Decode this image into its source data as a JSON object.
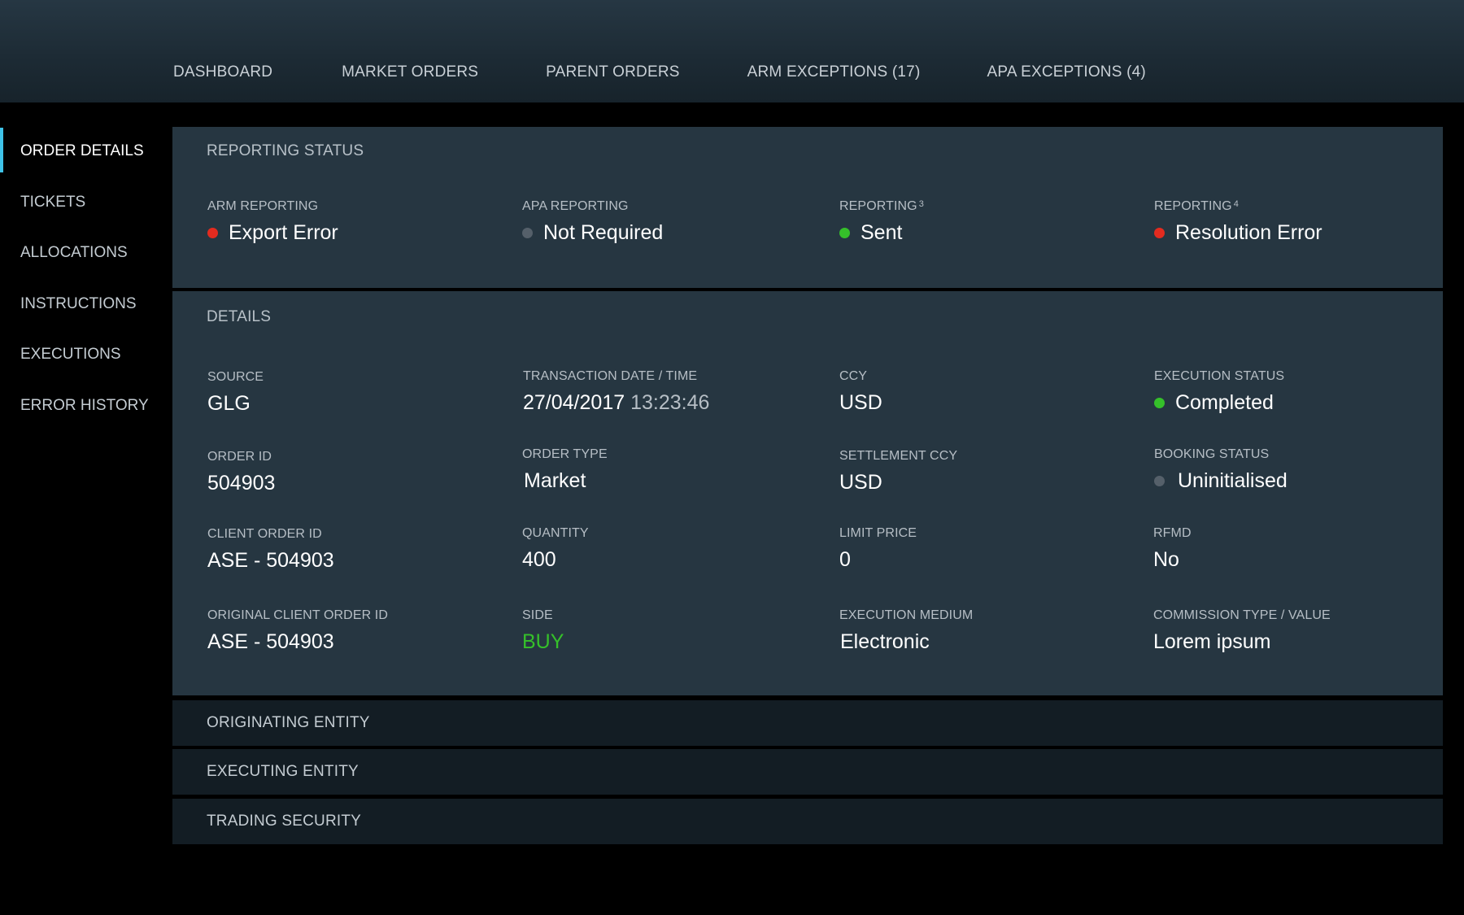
{
  "topnav": {
    "items": [
      {
        "label": "DASHBOARD"
      },
      {
        "label": "MARKET ORDERS"
      },
      {
        "label": "PARENT ORDERS"
      },
      {
        "label": "ARM EXCEPTIONS (17)"
      },
      {
        "label": "APA EXCEPTIONS (4)"
      }
    ]
  },
  "sidebar": {
    "items": [
      {
        "label": "ORDER DETAILS",
        "active": true
      },
      {
        "label": "TICKETS"
      },
      {
        "label": "ALLOCATIONS"
      },
      {
        "label": "INSTRUCTIONS"
      },
      {
        "label": "EXECUTIONS"
      },
      {
        "label": "ERROR HISTORY"
      }
    ]
  },
  "reporting_status": {
    "title": "REPORTING STATUS",
    "arm": {
      "label": "ARM REPORTING",
      "value": "Export Error",
      "status_color": "#e32b1f"
    },
    "apa": {
      "label": "APA REPORTING",
      "value": "Not Required",
      "status_color": "#55606a"
    },
    "rep3": {
      "label": "REPORTING",
      "sup": "3",
      "value": "Sent",
      "status_color": "#35c02a"
    },
    "rep4": {
      "label": "REPORTING",
      "sup": "4",
      "value": "Resolution Error",
      "status_color": "#e32b1f"
    }
  },
  "details": {
    "title": "DETAILS",
    "source": {
      "label": "SOURCE",
      "value": "GLG"
    },
    "transaction": {
      "label": "TRANSACTION DATE / TIME",
      "date": "27/04/2017",
      "time": "13:23:46"
    },
    "ccy": {
      "label": "CCY",
      "value": "USD"
    },
    "execution_status": {
      "label": "EXECUTION STATUS",
      "value": "Completed",
      "status_color": "#35c02a"
    },
    "order_id": {
      "label": "ORDER ID",
      "value": "504903"
    },
    "order_type": {
      "label": "ORDER TYPE",
      "value": "Market"
    },
    "settlement_ccy": {
      "label": "SETTLEMENT CCY",
      "value": "USD"
    },
    "booking_status": {
      "label": "BOOKING STATUS",
      "value": "Uninitialised",
      "status_color": "#55606a"
    },
    "client_order_id": {
      "label": "CLIENT ORDER ID",
      "value": "ASE - 504903"
    },
    "quantity": {
      "label": "QUANTITY",
      "value": "400"
    },
    "limit_price": {
      "label": "LIMIT PRICE",
      "value": "0"
    },
    "rfmd": {
      "label": "RFMD",
      "value": "No"
    },
    "original_client_order_id": {
      "label": "ORIGINAL CLIENT ORDER ID",
      "value": "ASE - 504903"
    },
    "side": {
      "label": "SIDE",
      "value": "BUY",
      "color": "#35c02a"
    },
    "execution_medium": {
      "label": "EXECUTION MEDIUM",
      "value": "Electronic"
    },
    "commission": {
      "label": "COMMISSION TYPE / VALUE",
      "value": "Lorem ipsum"
    }
  },
  "collapsed_sections": [
    {
      "title": "ORIGINATING ENTITY"
    },
    {
      "title": "EXECUTING ENTITY"
    },
    {
      "title": "TRADING SECURITY"
    }
  ],
  "colors": {
    "accent": "#3fc3e8",
    "error": "#e32b1f",
    "success": "#35c02a",
    "neutral": "#55606a"
  }
}
